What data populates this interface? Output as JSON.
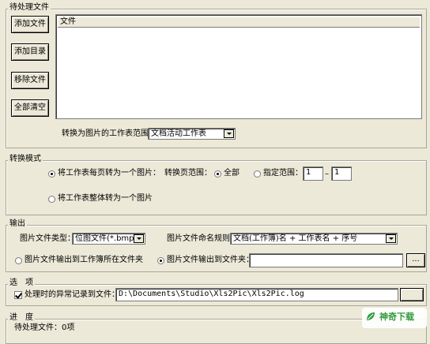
{
  "pending_files": {
    "group_title": "待处理文件",
    "buttons": {
      "add_file": "添加文件",
      "add_folder": "添加目录",
      "remove_file": "移除文件",
      "clear_all": "全部清空"
    },
    "list_column": "文件",
    "sheet_range_label": "转换为图片的工作表范围：",
    "sheet_range_value": "文档活动工作表"
  },
  "mode": {
    "group_title": "转换模式",
    "option_each_page": "将工作表每页转为一个图片：",
    "page_range_label": "转换页范围：",
    "option_all": "全部",
    "option_range": "指定范围：",
    "range_from": "1",
    "range_sep": "–",
    "range_to": "1",
    "option_whole_sheet": "将工作表整体转为一个图片",
    "selected": {
      "each_page": true,
      "all_pages": true
    }
  },
  "output": {
    "group_title": "输出",
    "type_label": "图片文件类型：",
    "type_value": "位图文件(*.bmp)",
    "naming_label": "图片文件命名规则：",
    "naming_value": "文档(工作簿)名 + 工作表名 + 序号",
    "option_to_workbook_folder": "图片文件输出到工作簿所在文件夹",
    "option_to_folder": "图片文件输出到文件夹：",
    "folder_value": "",
    "browse_label": "...",
    "selected_to_folder": true
  },
  "options": {
    "group_title": "选　项",
    "log_label": "处理时的异常记录到文件：",
    "log_checked": true,
    "log_path": "D:\\Documents\\Studio\\Xls2Pic\\Xls2Pic.log"
  },
  "progress": {
    "group_title": "进　度",
    "pending_count": "待处理文件：0项"
  },
  "watermark": {
    "text": "神奇下载"
  },
  "colors": {
    "window_bg": "#ECE9D8",
    "logo_green": "#2E9B3A"
  }
}
